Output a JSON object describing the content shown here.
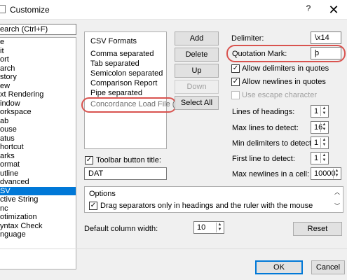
{
  "window": {
    "title": "Customize",
    "help_label": "?",
    "close_label": "✕"
  },
  "search": {
    "value": "earch (Ctrl+F)"
  },
  "tree": {
    "items": [
      "e",
      "it",
      "ort",
      "arch",
      "story",
      "ew",
      "xt Rendering",
      "indow",
      "orkspace",
      "ab",
      "ouse",
      "atus",
      "hortcut",
      "arks",
      "ormat",
      "utline",
      "dvanced",
      "SV",
      "ctive String",
      "nc",
      "otimization",
      "yntax Check",
      "nguage"
    ],
    "selected_index": 17
  },
  "formats": {
    "header": "CSV Formats",
    "items": [
      "Comma separated",
      "Tab separated",
      "Semicolon separated",
      "Comparison Report",
      "Pipe separated",
      "Concordance Load File (DAT)"
    ],
    "highlighted": "Concordance Load File (DAT)"
  },
  "buttons": {
    "add": "Add",
    "delete": "Delete",
    "up": "Up",
    "down": "Down",
    "select_all": "Select All"
  },
  "toolbar_title": {
    "label": "Toolbar button title:",
    "value": "DAT",
    "checked": true
  },
  "delimiter": {
    "label": "Delimiter:",
    "value": "\\x14"
  },
  "quotation": {
    "label": "Quotation Mark:",
    "value": "þ"
  },
  "checks": {
    "allow_delimiters": {
      "label": "Allow delimiters in quotes",
      "checked": true
    },
    "allow_newlines": {
      "label": "Allow newlines in quotes",
      "checked": true
    },
    "escape": {
      "label": "Use escape character",
      "checked": false,
      "disabled": true
    }
  },
  "spinners": [
    {
      "label": "Lines of headings:",
      "value": "1"
    },
    {
      "label": "Max lines to detect:",
      "value": "16"
    },
    {
      "label": "Min delimiters to detect:",
      "value": "1"
    },
    {
      "label": "First line to detect:",
      "value": "1"
    },
    {
      "label": "Max newlines in a cell:",
      "value": "10000"
    }
  ],
  "options": {
    "header": "Options",
    "item": "Drag separators only in headings and the ruler with the mouse",
    "checked": true
  },
  "column_width": {
    "label": "Default column width:",
    "value": "10"
  },
  "reset_label": "Reset",
  "ok_label": "OK",
  "cancel_label": "Cancel",
  "colors": {
    "selection": "#0078d7",
    "highlight_oval": "#d9534f"
  }
}
